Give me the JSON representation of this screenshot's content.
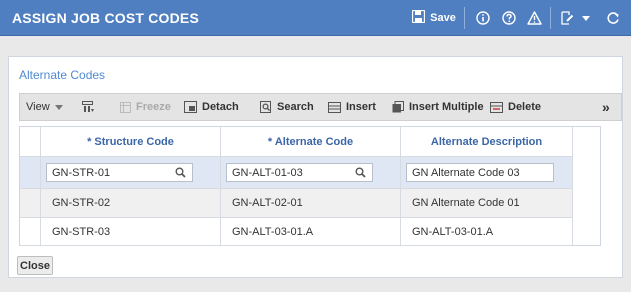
{
  "window": {
    "title": "ASSIGN JOB COST CODES",
    "save_label": "Save",
    "icons": [
      "save-icon",
      "info-icon",
      "help-icon",
      "warning-icon",
      "edit-icon",
      "chevron-down-icon",
      "refresh-icon"
    ]
  },
  "panel": {
    "title": "Alternate Codes"
  },
  "toolbar": {
    "view": "View",
    "freeze": "Freeze",
    "detach": "Detach",
    "search": "Search",
    "insert": "Insert",
    "insert_multiple": "Insert Multiple",
    "delete": "Delete",
    "overflow": "»"
  },
  "grid": {
    "columns": [
      "* Structure Code",
      "* Alternate Code",
      "Alternate Description"
    ],
    "rows": [
      [
        "GN-STR-01",
        "GN-ALT-01-03",
        "GN Alternate Code 03"
      ],
      [
        "GN-STR-02",
        "GN-ALT-02-01",
        "GN Alternate Code 01"
      ],
      [
        "GN-STR-03",
        "GN-ALT-03-01.A",
        "GN-ALT-03-01.A"
      ]
    ]
  },
  "footer": {
    "close": "Close"
  },
  "colors": {
    "header_bar": "#4f7fc1",
    "panel_title": "#4f8ad1",
    "column_header": "#3b66a8",
    "selected_row": "#dfe7f4"
  }
}
